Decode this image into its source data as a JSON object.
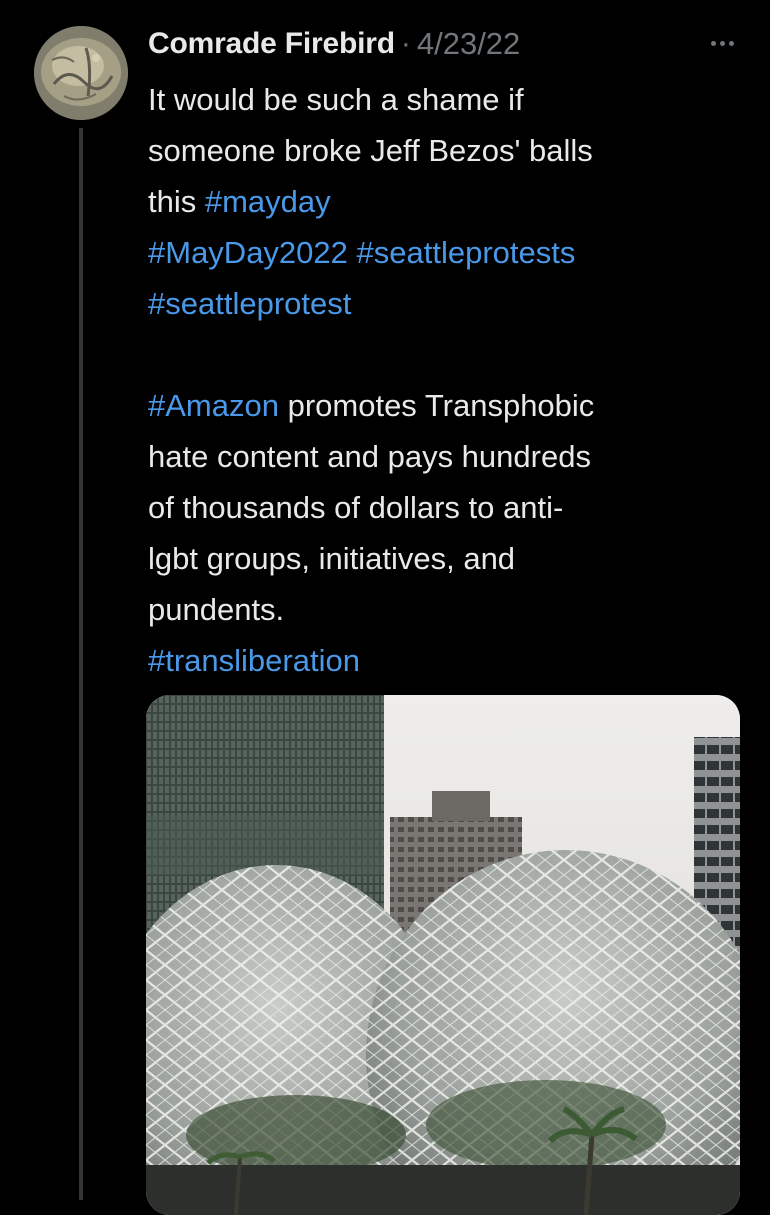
{
  "tweet": {
    "author_name": "Comrade Firebird",
    "separator": "·",
    "timestamp": "4/23/22",
    "lines": [
      [
        {
          "text": "It would be such a shame if",
          "type": "text"
        }
      ],
      [
        {
          "text": "someone broke Jeff Bezos' balls",
          "type": "text"
        }
      ],
      [
        {
          "text": "this ",
          "type": "text"
        },
        {
          "text": "#mayday",
          "type": "hashtag"
        }
      ],
      [
        {
          "text": "#MayDay2022",
          "type": "hashtag"
        },
        {
          "text": " ",
          "type": "text"
        },
        {
          "text": "#seattleprotests",
          "type": "hashtag"
        }
      ],
      [
        {
          "text": "#seattleprotest",
          "type": "hashtag"
        }
      ],
      [],
      [
        {
          "text": "#Amazon",
          "type": "hashtag"
        },
        {
          "text": " promotes Transphobic",
          "type": "text"
        }
      ],
      [
        {
          "text": "hate content and pays hundreds",
          "type": "text"
        }
      ],
      [
        {
          "text": "of thousands of dollars to anti-",
          "type": "text"
        }
      ],
      [
        {
          "text": "lgbt groups, initiatives, and",
          "type": "text"
        }
      ],
      [
        {
          "text": "pundents.",
          "type": "text"
        }
      ],
      [
        {
          "text": "#transliberation",
          "type": "hashtag"
        }
      ]
    ],
    "more_icon": "more-horizontal-icon"
  },
  "colors": {
    "background": "#000000",
    "text": "#e7e9ea",
    "muted": "#71767b",
    "link": "#4a99e9",
    "thread_line": "#333639"
  }
}
